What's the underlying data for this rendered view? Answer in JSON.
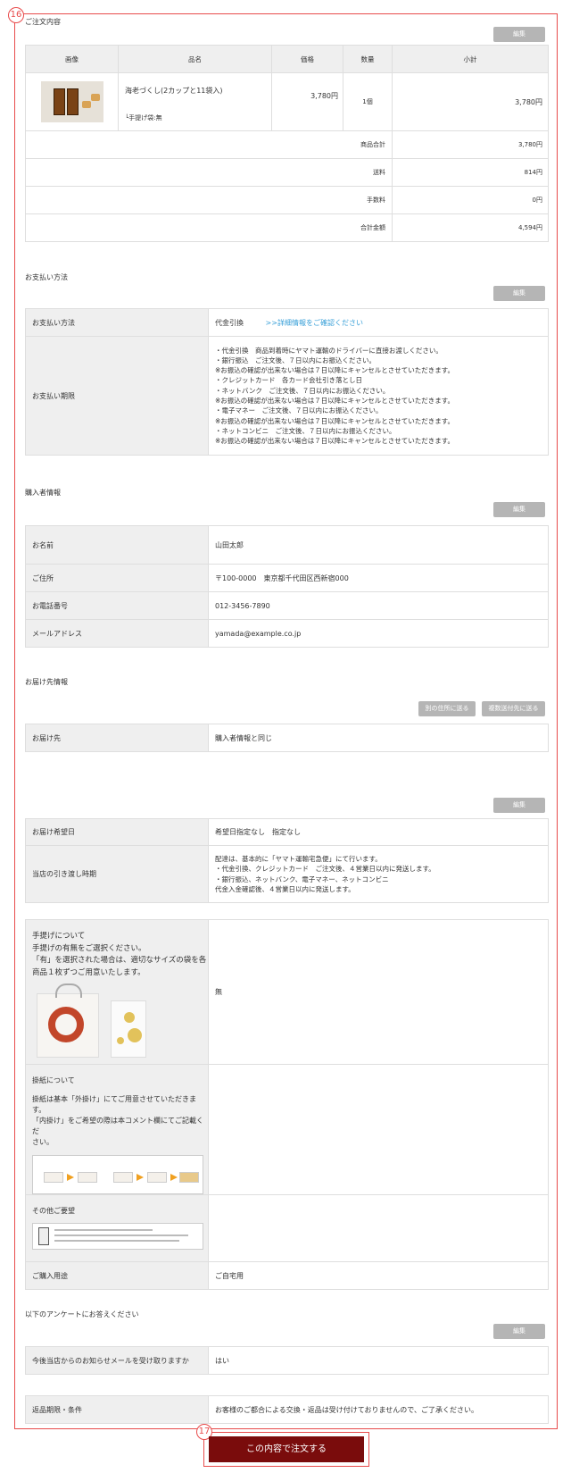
{
  "callouts": {
    "first": "16",
    "second": "17"
  },
  "order": {
    "title": "ご注文内容",
    "edit": "編集",
    "headers": [
      "画像",
      "品名",
      "価格",
      "数量",
      "小計"
    ],
    "item": {
      "name": "海老づくし(2カップと11袋入)",
      "option": "└手提げ袋:無",
      "price": "3,780円",
      "qty": "1個",
      "subtotal": "3,780円"
    },
    "summary": [
      {
        "label": "商品合計",
        "value": "3,780円"
      },
      {
        "label": "送料",
        "value": "814円"
      },
      {
        "label": "手数料",
        "value": "0円"
      },
      {
        "label": "合計金額",
        "value": "4,594円"
      }
    ]
  },
  "payment": {
    "title": "お支払い方法",
    "edit": "編集",
    "method_label": "お支払い方法",
    "method_value": "代金引換",
    "method_link": ">>詳細情報をご確認ください",
    "deadline_label": "お支払い期限",
    "deadline_lines": [
      "・代金引換　商品到着時にヤマト運輸のドライバーに直接お渡しください。",
      "・銀行振込　ご注文後、７日以内にお振込ください。",
      "※お振込の確認が出来ない場合は７日以降にキャンセルとさせていただきます。",
      "・クレジットカード　各カード会社引き落とし日",
      "・ネットバンク　ご注文後、７日以内にお振込ください。",
      "※お振込の確認が出来ない場合は７日以降にキャンセルとさせていただきます。",
      "・電子マネー　ご注文後、７日以内にお振込ください。",
      "※お振込の確認が出来ない場合は７日以降にキャンセルとさせていただきます。",
      "・ネットコンビニ　ご注文後、７日以内にお振込ください。",
      "※お振込の確認が出来ない場合は７日以降にキャンセルとさせていただきます。"
    ]
  },
  "buyer": {
    "title": "購入者情報",
    "edit": "編集",
    "rows": [
      {
        "label": "お名前",
        "value": "山田太郎"
      },
      {
        "label": "ご住所",
        "value": "〒100-0000　東京都千代田区西新宿000"
      },
      {
        "label": "お電話番号",
        "value": "012-3456-7890"
      },
      {
        "label": "メールアドレス",
        "value": "yamada@example.co.jp"
      }
    ]
  },
  "delivery": {
    "title": "お届け先情報",
    "btn_other": "別の住所に送る",
    "btn_multi": "複数送付先に送る",
    "dest_label": "お届け先",
    "dest_value": "購入者情報と同じ",
    "edit": "編集",
    "date_label": "お届け希望日",
    "date_value": "希望日指定なし　指定なし",
    "ship_label": "当店の引き渡し時期",
    "ship_lines": [
      "配達は、基本的に「ヤマト運輸宅急便」にて行います。",
      "・代金引換、クレジットカード　ご注文後、４営業日以内に発送します。",
      "・銀行振込、ネットバンク、電子マネー、ネットコンビニ",
      "代金入金確認後、４営業日以内に発送します。"
    ]
  },
  "options": {
    "bag_lines": [
      "手提げについて",
      "手提げの有無をご選択ください。",
      "「有」を選択された場合は、適切なサイズの袋を各",
      "商品１枚ずつご用意いたします。"
    ],
    "bag_value": "無",
    "paper_title": "掛紙について",
    "paper_lines": [
      "掛紙は基本「外掛け」にてご用意させていただきます。",
      "「内掛け」をご希望の際は本コメント欄にてご記載くだ",
      "さい。"
    ],
    "other_title": "その他ご要望",
    "purpose_label": "ご購入用途",
    "purpose_value": "ご自宅用"
  },
  "survey": {
    "title": "以下のアンケートにお答えください",
    "edit": "編集",
    "q_label": "今後当店からのお知らせメールを受け取りますか",
    "q_value": "はい"
  },
  "returns": {
    "label": "返品期限・条件",
    "value": "お客様のご都合による交換・返品は受け付けておりませんので、ご了承ください。"
  },
  "submit": {
    "label": "この内容で注文する"
  }
}
